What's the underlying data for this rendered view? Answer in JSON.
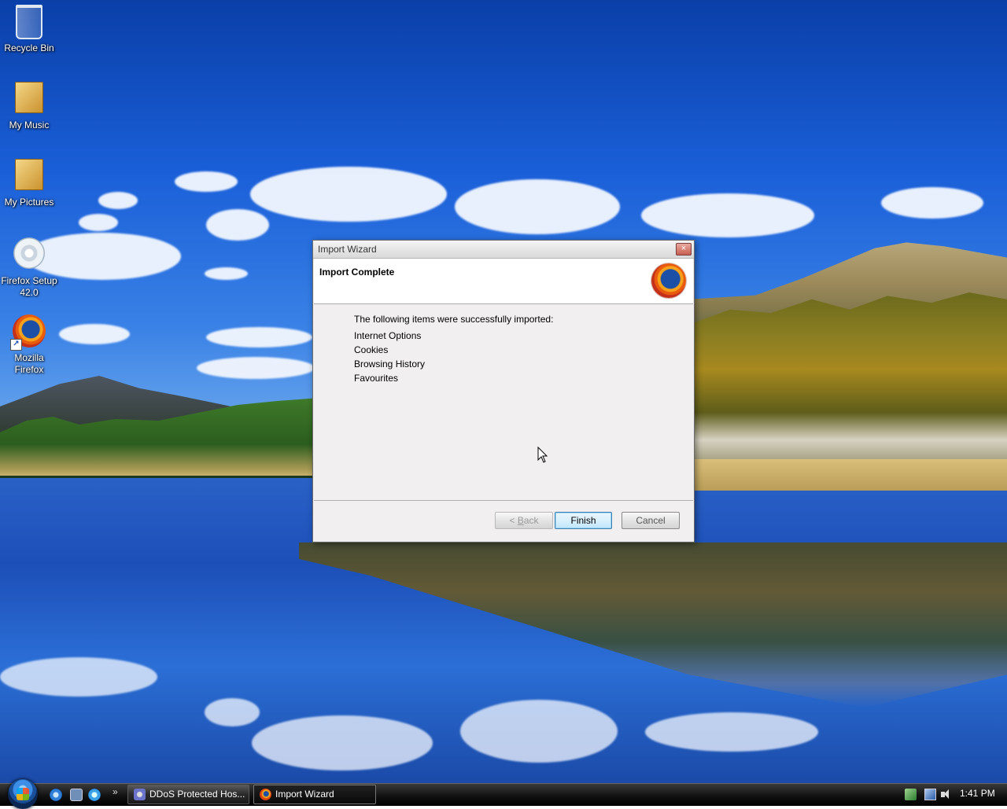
{
  "desktop": {
    "icons": [
      {
        "label": "Recycle Bin",
        "icon": "recycle-bin-icon"
      },
      {
        "label": "My Music",
        "icon": "music-folder-icon"
      },
      {
        "label": "My Pictures",
        "icon": "pictures-folder-icon"
      },
      {
        "label": "Firefox Setup 42.0",
        "icon": "installer-icon"
      },
      {
        "label": "Mozilla Firefox",
        "icon": "firefox-icon"
      }
    ]
  },
  "dialog": {
    "title": "Import Wizard",
    "close_label": "×",
    "header_title": "Import Complete",
    "logo_icon": "firefox-logo-icon",
    "intro": "The following items were successfully imported:",
    "items": [
      "Internet Options",
      "Cookies",
      "Browsing History",
      "Favourites"
    ],
    "buttons": {
      "back_prefix": "< ",
      "back_mnemonic": "B",
      "back_rest": "ack",
      "finish": "Finish",
      "cancel": "Cancel"
    }
  },
  "taskbar": {
    "start_icon": "windows-start-orb-icon",
    "quick_launch": [
      "ie-icon",
      "switch-windows-icon",
      "ie-icon"
    ],
    "more_label": "»",
    "tasks": [
      {
        "label": "DDoS Protected Hos...",
        "icon": "app-icon",
        "active": false
      },
      {
        "label": "Import Wizard",
        "icon": "firefox-icon",
        "active": true
      }
    ],
    "tray_icons": [
      "network-icon",
      "network-icon",
      "volume-icon"
    ],
    "clock": "1:41 PM"
  }
}
